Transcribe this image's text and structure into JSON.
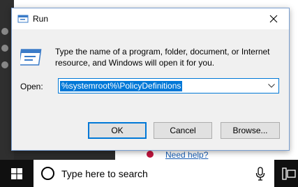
{
  "dialog": {
    "title": "Run",
    "description": "Type the name of a program, folder, document, or Internet resource, and Windows will open it for you.",
    "open_label": "Open:",
    "open_value": "%systemroot%\\PolicyDefinitions",
    "buttons": {
      "ok": "OK",
      "cancel": "Cancel",
      "browse": "Browse..."
    }
  },
  "background": {
    "help_link": "Need help?"
  },
  "taskbar": {
    "search_placeholder": "Type here to search"
  },
  "colors": {
    "accent": "#0078d7",
    "taskbar": "#101010",
    "dialog_bg": "#f0f0f0"
  }
}
